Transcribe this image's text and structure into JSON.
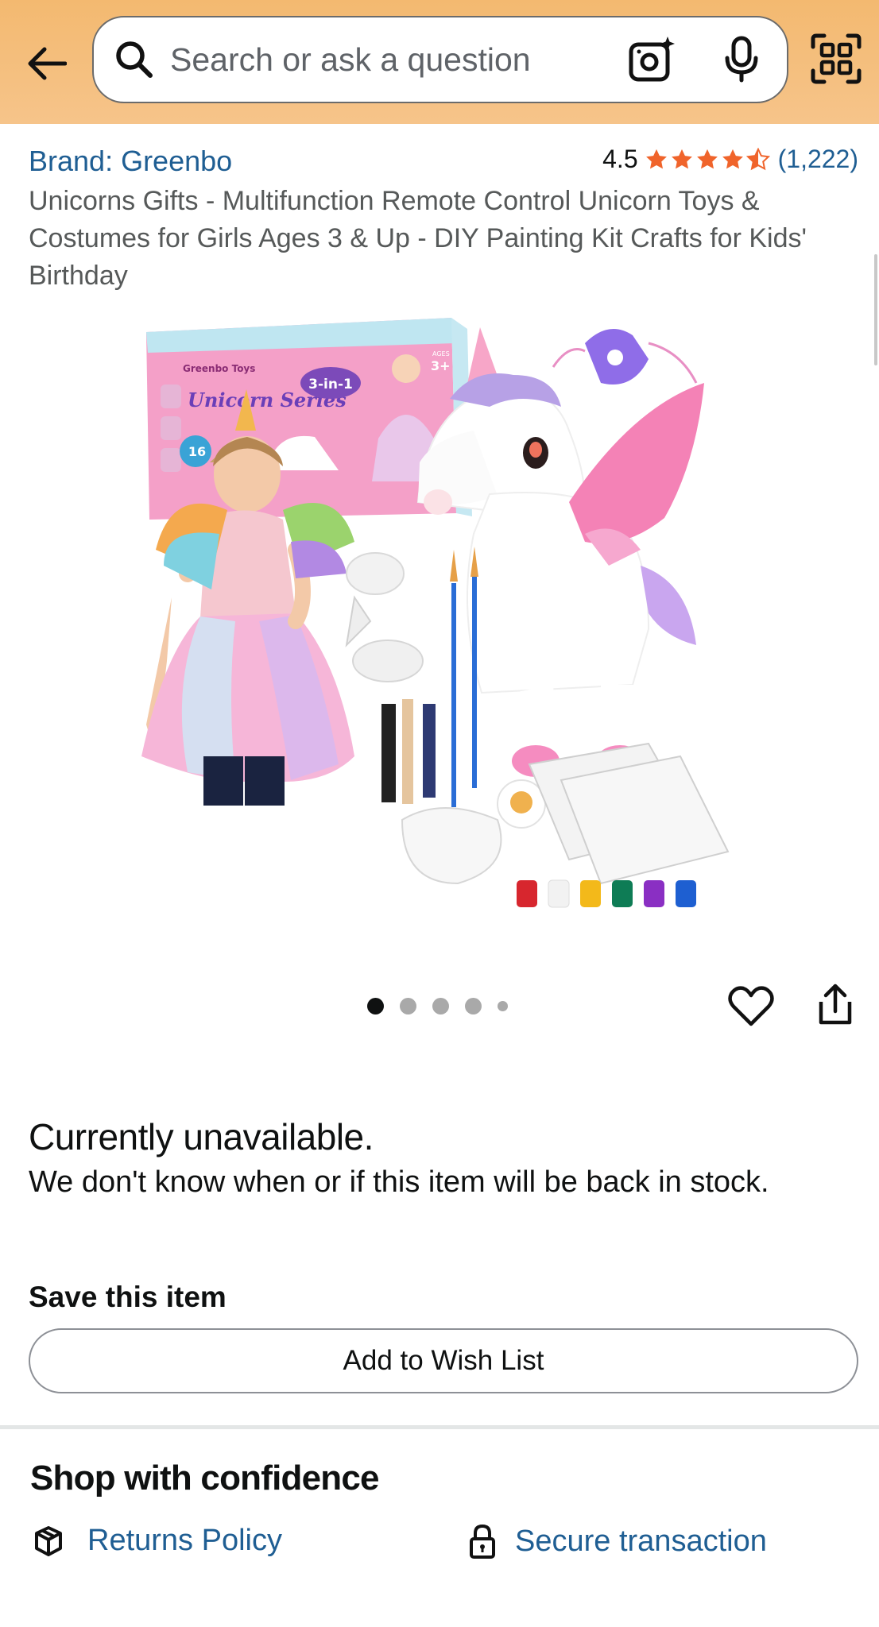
{
  "search": {
    "placeholder": "Search or ask a question"
  },
  "product": {
    "brand": "Brand: Greenbo",
    "rating": "4.5",
    "rating_stars": 4.5,
    "review_count": "(1,222)",
    "title": "Unicorns Gifts - Multifunction Remote Control Unicorn Toys & Costumes for Girls Ages 3 & Up - DIY Painting Kit Crafts for Kids' Birthday",
    "image_alt": "Unicorn toy, costume and painting kit set",
    "box_text": {
      "brand": "Greenbo Toys",
      "series": "Unicorn Series",
      "badge": "3-in-1",
      "ages_label": "AGES",
      "ages_value": "3+",
      "count": "16"
    }
  },
  "carousel": {
    "total": 5,
    "active_index": 0
  },
  "availability": {
    "title": "Currently unavailable.",
    "message": "We don't know when or if this item will be back in stock."
  },
  "save": {
    "label": "Save this item",
    "wishlist_button": "Add to Wish List"
  },
  "confidence": {
    "title": "Shop with confidence",
    "returns": "Returns Policy",
    "secure": "Secure transaction"
  },
  "colors": {
    "header_bg": "#f3b970",
    "link": "#1f5e93",
    "star": "#f0642b",
    "text": "#0f1111",
    "muted": "#565959"
  }
}
